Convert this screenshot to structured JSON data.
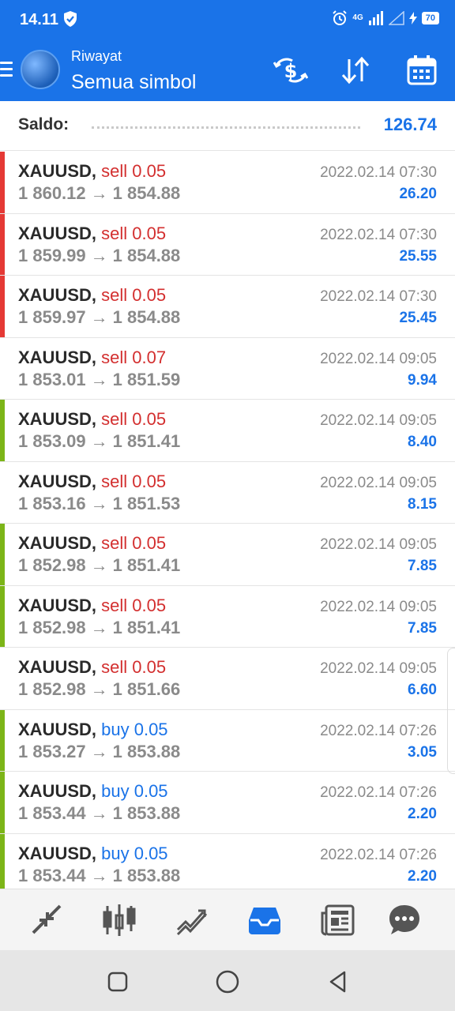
{
  "status_bar": {
    "time": "14.11",
    "network": "4G",
    "battery": "70"
  },
  "header": {
    "subtitle": "Riwayat",
    "title": "Semua simbol"
  },
  "balance": {
    "label": "Saldo:",
    "value": "126.74"
  },
  "trades": [
    {
      "symbol": "XAUUSD,",
      "side": "sell 0.05",
      "direction": "sell",
      "open": "1 860.12",
      "close": "1 854.88",
      "date": "2022.02.14 07:30",
      "profit": "26.20",
      "marker": "#e53935"
    },
    {
      "symbol": "XAUUSD,",
      "side": "sell 0.05",
      "direction": "sell",
      "open": "1 859.99",
      "close": "1 854.88",
      "date": "2022.02.14 07:30",
      "profit": "25.55",
      "marker": "#e53935"
    },
    {
      "symbol": "XAUUSD,",
      "side": "sell 0.05",
      "direction": "sell",
      "open": "1 859.97",
      "close": "1 854.88",
      "date": "2022.02.14 07:30",
      "profit": "25.45",
      "marker": "#e53935"
    },
    {
      "symbol": "XAUUSD,",
      "side": "sell 0.07",
      "direction": "sell",
      "open": "1 853.01",
      "close": "1 851.59",
      "date": "2022.02.14 09:05",
      "profit": "9.94",
      "marker": ""
    },
    {
      "symbol": "XAUUSD,",
      "side": "sell 0.05",
      "direction": "sell",
      "open": "1 853.09",
      "close": "1 851.41",
      "date": "2022.02.14 09:05",
      "profit": "8.40",
      "marker": "#7cb518"
    },
    {
      "symbol": "XAUUSD,",
      "side": "sell 0.05",
      "direction": "sell",
      "open": "1 853.16",
      "close": "1 851.53",
      "date": "2022.02.14 09:05",
      "profit": "8.15",
      "marker": ""
    },
    {
      "symbol": "XAUUSD,",
      "side": "sell 0.05",
      "direction": "sell",
      "open": "1 852.98",
      "close": "1 851.41",
      "date": "2022.02.14 09:05",
      "profit": "7.85",
      "marker": "#7cb518"
    },
    {
      "symbol": "XAUUSD,",
      "side": "sell 0.05",
      "direction": "sell",
      "open": "1 852.98",
      "close": "1 851.41",
      "date": "2022.02.14 09:05",
      "profit": "7.85",
      "marker": "#7cb518"
    },
    {
      "symbol": "XAUUSD,",
      "side": "sell 0.05",
      "direction": "sell",
      "open": "1 852.98",
      "close": "1 851.66",
      "date": "2022.02.14 09:05",
      "profit": "6.60",
      "marker": ""
    },
    {
      "symbol": "XAUUSD,",
      "side": "buy 0.05",
      "direction": "buy",
      "open": "1 853.27",
      "close": "1 853.88",
      "date": "2022.02.14 07:26",
      "profit": "3.05",
      "marker": "#7cb518"
    },
    {
      "symbol": "XAUUSD,",
      "side": "buy 0.05",
      "direction": "buy",
      "open": "1 853.44",
      "close": "1 853.88",
      "date": "2022.02.14 07:26",
      "profit": "2.20",
      "marker": "#7cb518"
    },
    {
      "symbol": "XAUUSD,",
      "side": "buy 0.05",
      "direction": "buy",
      "open": "1 853.44",
      "close": "1 853.88",
      "date": "2022.02.14 07:26",
      "profit": "2.20",
      "marker": "#7cb518"
    }
  ],
  "colors": {
    "accent": "#1a73e8",
    "sell": "#d32f2f",
    "buy": "#1a73e8",
    "loss_marker": "#e53935",
    "profit_marker": "#7cb518"
  },
  "icons": {
    "header_actions": [
      "currency-exchange-icon",
      "sort-icon",
      "calendar-icon"
    ],
    "bottom_tabs": [
      "quotes-icon",
      "chart-icon",
      "trade-icon",
      "history-icon",
      "news-icon",
      "chat-icon"
    ],
    "active_tab": "history-icon"
  }
}
